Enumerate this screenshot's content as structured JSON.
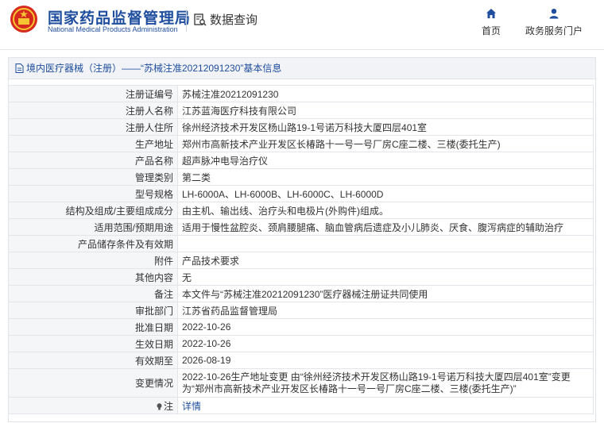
{
  "header": {
    "brand_cn": "国家药品监督管理局",
    "brand_en": "National Medical Products Administration",
    "query_label": "数据查询",
    "nav": [
      {
        "label": "首页",
        "icon": "home-icon"
      },
      {
        "label": "政务服务门户",
        "icon": "user-icon"
      }
    ],
    "brand_color": "#1f4e9e"
  },
  "panel": {
    "title": "境内医疗器械（注册）——“苏械注准20212091230”基本信息"
  },
  "rows": [
    {
      "key": "注册证编号",
      "value": "苏械注准20212091230"
    },
    {
      "key": "注册人名称",
      "value": "江苏蓝海医疗科技有限公司"
    },
    {
      "key": "注册人住所",
      "value": "徐州经济技术开发区杨山路19-1号诺万科技大厦四层401室"
    },
    {
      "key": "生产地址",
      "value": "郑州市高新技术产业开发区长椿路十一号一号厂房C座二楼、三楼(委托生产)"
    },
    {
      "key": "产品名称",
      "value": "超声脉冲电导治疗仪"
    },
    {
      "key": "管理类别",
      "value": "第二类"
    },
    {
      "key": "型号规格",
      "value": "LH-6000A、LH-6000B、LH-6000C、LH-6000D"
    },
    {
      "key": "结构及组成/主要组成成分",
      "value": "由主机、输出线、治疗头和电极片(外购件)组成。"
    },
    {
      "key": "适用范围/预期用途",
      "value": "适用于慢性盆腔炎、颈肩腰腿痛、脑血管病后遗症及小儿肺炎、厌食、腹泻病症的辅助治疗"
    },
    {
      "key": "产品储存条件及有效期",
      "value": ""
    },
    {
      "key": "附件",
      "value": "产品技术要求"
    },
    {
      "key": "其他内容",
      "value": "无"
    },
    {
      "key": "备注",
      "value": "本文件与“苏械注准20212091230”医疗器械注册证共同使用"
    },
    {
      "key": "审批部门",
      "value": "江苏省药品监督管理局"
    },
    {
      "key": "批准日期",
      "value": "2022-10-26"
    },
    {
      "key": "生效日期",
      "value": "2022-10-26"
    },
    {
      "key": "有效期至",
      "value": "2026-08-19"
    },
    {
      "key": "变更情况",
      "value": "2022-10-26生产地址变更 由“徐州经济技术开发区杨山路19-1号诺万科技大厦四层401室”变更为“郑州市高新技术产业开发区长椿路十一号一号厂房C座二楼、三楼(委托生产)”"
    }
  ],
  "note": {
    "key": "注",
    "value": "详情",
    "icon": "lightbulb-icon"
  }
}
